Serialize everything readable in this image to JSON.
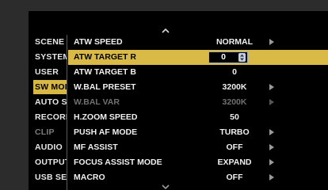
{
  "tabs": [
    {
      "label": "SCENE",
      "state": "normal"
    },
    {
      "label": "SYSTEM",
      "state": "normal"
    },
    {
      "label": "USER",
      "state": "normal"
    },
    {
      "label": "SW MODE",
      "state": "active"
    },
    {
      "label": "AUTO SW",
      "state": "normal"
    },
    {
      "label": "RECORDING",
      "state": "normal"
    },
    {
      "label": "CLIP",
      "state": "dim"
    },
    {
      "label": "AUDIO",
      "state": "normal"
    },
    {
      "label": "OUTPUT",
      "state": "normal"
    },
    {
      "label": "USB SETUP",
      "state": "normal"
    }
  ],
  "scroll": {
    "up_icon": "chevron-up-icon",
    "down_icon": "chevron-down-icon"
  },
  "items": [
    {
      "label": "ATW SPEED",
      "value": "NORMAL",
      "has_submenu": true,
      "state": "normal"
    },
    {
      "label": "ATW TARGET R",
      "value": "0",
      "has_submenu": false,
      "state": "editing"
    },
    {
      "label": "ATW TARGET B",
      "value": "0",
      "has_submenu": false,
      "state": "normal"
    },
    {
      "label": "W.BAL PRESET",
      "value": "3200K",
      "has_submenu": true,
      "state": "normal"
    },
    {
      "label": "W.BAL VAR",
      "value": "3200K",
      "has_submenu": true,
      "state": "dim"
    },
    {
      "label": "H.ZOOM SPEED",
      "value": "50",
      "has_submenu": false,
      "state": "normal"
    },
    {
      "label": "PUSH AF MODE",
      "value": "TURBO",
      "has_submenu": true,
      "state": "normal"
    },
    {
      "label": "MF ASSIST",
      "value": "OFF",
      "has_submenu": true,
      "state": "normal"
    },
    {
      "label": "FOCUS ASSIST MODE",
      "value": "EXPAND",
      "has_submenu": true,
      "state": "normal"
    },
    {
      "label": "MACRO",
      "value": "OFF",
      "has_submenu": true,
      "state": "normal"
    }
  ],
  "colors": {
    "highlight": "#d9ba47",
    "background": "#000000",
    "text": "#efefef",
    "dim_text": "#707070"
  }
}
